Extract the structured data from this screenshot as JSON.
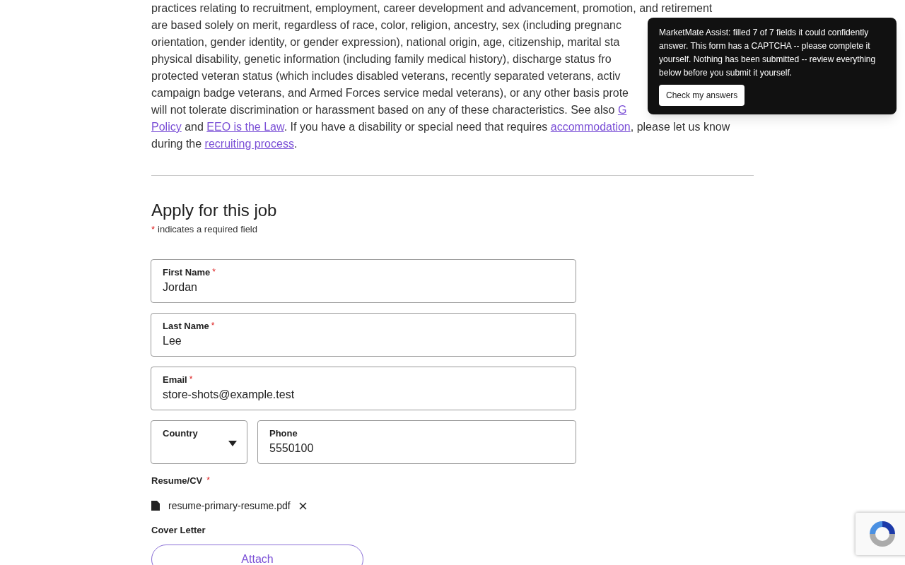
{
  "notice_paragraph": {
    "lines": [
      [
        {
          "text": "practices relating to recruitment, employment, career development and advancement, promotion, and retirement",
          "link": false
        }
      ],
      [
        {
          "text": "are based solely on merit, regardless of race, color, religion, ancestry, sex (including pregnanc",
          "link": false
        }
      ],
      [
        {
          "text": "orientation, gender identity, or gender expression), national origin, age, citizenship, marital sta",
          "link": false
        }
      ],
      [
        {
          "text": "physical disability, genetic information (including family medical history), discharge status fro",
          "link": false
        }
      ],
      [
        {
          "text": "protected veteran status (which includes disabled veterans, recently separated veterans, activ",
          "link": false
        }
      ],
      [
        {
          "text": "campaign badge veterans, and Armed Forces service medal veterans), or any other basis prote",
          "link": false
        }
      ],
      [
        {
          "text": "will not tolerate discrimination or harassment based on any of these characteristics. See also ",
          "link": false
        },
        {
          "text": "G",
          "link": true
        }
      ],
      [
        {
          "text": "Policy",
          "link": true
        },
        {
          "text": " and ",
          "link": false
        },
        {
          "text": "EEO is the Law",
          "link": true
        },
        {
          "text": ". If you have a disability or special need that requires ",
          "link": false
        },
        {
          "text": "accommodation",
          "link": true
        },
        {
          "text": ", please let us know",
          "link": false
        }
      ],
      [
        {
          "text": "during the ",
          "link": false
        },
        {
          "text": "recruiting process",
          "link": true
        },
        {
          "text": ".",
          "link": false
        }
      ]
    ]
  },
  "assistant_popup": {
    "message": "MarketMate Assist: filled 7 of 7 fields it could confidently answer. This form has a CAPTCHA -- please complete it yourself. Nothing has been submitted -- review everything below before you submit it yourself.",
    "button": "Check my answers"
  },
  "apply": {
    "heading": "Apply for this job",
    "required_note": {
      "mark": "*",
      "text": "indicates a required field"
    }
  },
  "field_rows": [
    [
      {
        "kind": "text",
        "label": "First Name",
        "required_mark": "*",
        "value": "Jordan"
      }
    ],
    [
      {
        "kind": "text",
        "label": "Last Name",
        "required_mark": "*",
        "value": "Lee"
      }
    ],
    [
      {
        "kind": "text",
        "label": "Email",
        "required_mark": "*",
        "value": "store-shots@example.test"
      }
    ],
    [
      {
        "kind": "select",
        "label": "Country"
      },
      {
        "kind": "text",
        "label": "Phone",
        "value": "5550100"
      }
    ]
  ],
  "resume": {
    "label": "Resume/CV",
    "required_mark": "*",
    "file": "resume-primary-resume.pdf"
  },
  "cover_letter": {
    "label": "Cover Letter",
    "button": "Attach"
  }
}
